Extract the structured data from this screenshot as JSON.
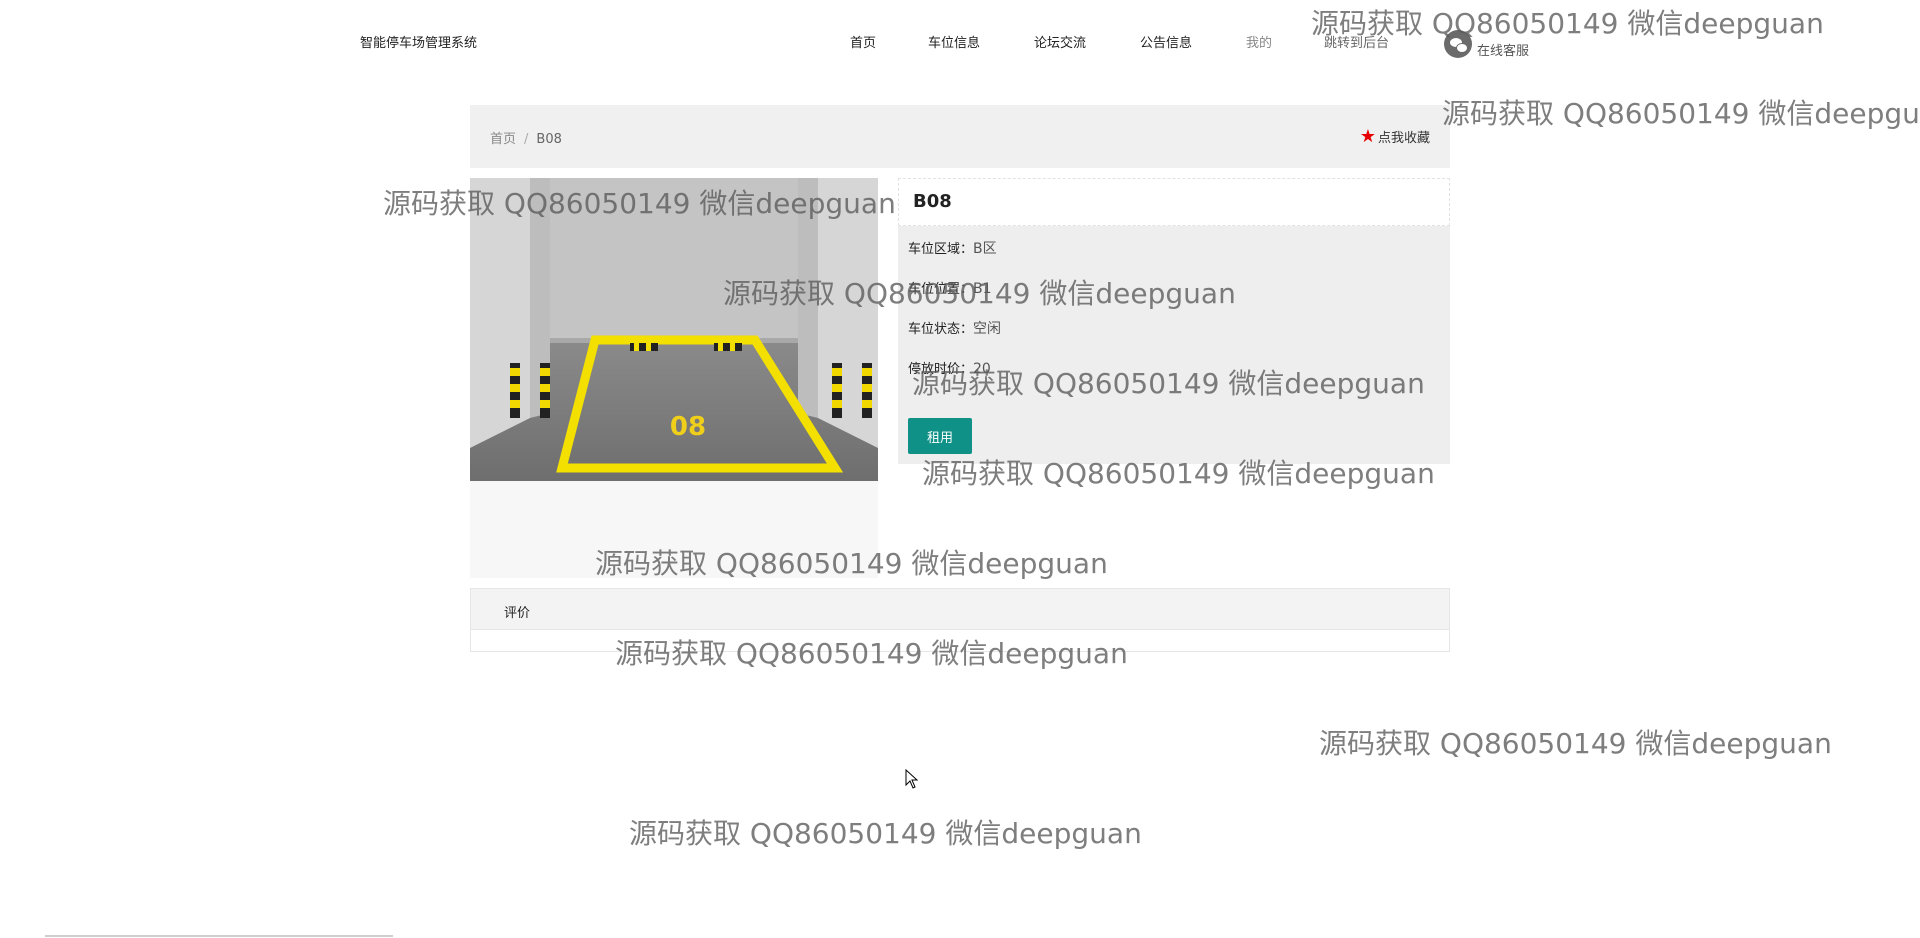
{
  "header": {
    "site_title": "智能停车场管理系统",
    "nav": [
      "首页",
      "车位信息",
      "论坛交流",
      "公告信息",
      "我的",
      "跳转到后台"
    ],
    "service_label": "在线客服",
    "service_icon": "wechat-icon"
  },
  "breadcrumb": {
    "home": "首页",
    "separator": "/",
    "current": "B08"
  },
  "favorite": {
    "label": "点我收藏",
    "icon": "star-icon"
  },
  "detail": {
    "title": "B08",
    "fields": [
      {
        "label": "车位区域：",
        "value": "B区"
      },
      {
        "label": "车位位置：",
        "value": "B1"
      },
      {
        "label": "车位状态：",
        "value": "空闲"
      },
      {
        "label": "停放时价：",
        "value": "20"
      }
    ],
    "rent_button": "租用",
    "photo_number": "08"
  },
  "review": {
    "title": "评价"
  },
  "watermark": "源码获取 QQ86050149 微信deepguan",
  "colors": {
    "accent": "#0f9187",
    "star": "#e60000"
  }
}
